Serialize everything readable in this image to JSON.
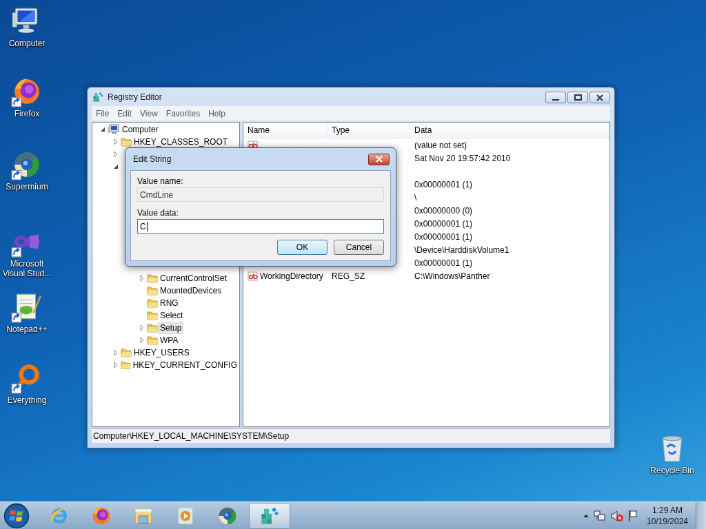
{
  "desktop_icons": [
    {
      "kind": "computer",
      "label": "Computer",
      "shortcut": false
    },
    {
      "kind": "firefox",
      "label": "Firefox",
      "shortcut": true
    },
    {
      "kind": "supermium",
      "label": "Supermium",
      "shortcut": true
    },
    {
      "kind": "vs",
      "label": "Microsoft Visual Stud...",
      "shortcut": true
    },
    {
      "kind": "notepad",
      "label": "Notepad++",
      "shortcut": true
    },
    {
      "kind": "everything",
      "label": "Everything",
      "shortcut": true
    },
    {
      "kind": "recycle",
      "label": "Recycle Bin",
      "shortcut": false
    }
  ],
  "registry_editor": {
    "title": "Registry Editor",
    "menu": [
      "File",
      "Edit",
      "View",
      "Favorites",
      "Help"
    ],
    "tree": {
      "label": "Computer",
      "kind": "computer",
      "expanded": true,
      "selected": false,
      "children": [
        {
          "label": "HKEY_CLASSES_ROOT",
          "expanded": false,
          "selected": false
        },
        {
          "expanded": false
        },
        {
          "expanded": true,
          "children": [
            {
              "covered": true
            },
            {
              "covered": true
            },
            {
              "covered": true
            },
            {
              "covered": true
            },
            {
              "covered": true
            },
            {
              "covered": true,
              "children": [
                {
                  "covered": true
                },
                {
                  "covered": true
                },
                {
                  "label": "CurrentControlSet",
                  "expanded": false,
                  "selected": false
                },
                {
                  "label": "MountedDevices",
                  "selected": false
                },
                {
                  "label": "RNG",
                  "selected": false
                },
                {
                  "label": "Select",
                  "selected": false
                },
                {
                  "label": "Setup",
                  "expanded": false,
                  "selected": true
                },
                {
                  "label": "WPA",
                  "expanded": false,
                  "selected": false
                }
              ]
            }
          ]
        },
        {
          "label": "HKEY_USERS",
          "expanded": false,
          "selected": false
        },
        {
          "label": "HKEY_CURRENT_CONFIG",
          "expanded": false,
          "selected": false
        }
      ]
    },
    "columns": [
      "Name",
      "Type",
      "Data"
    ],
    "rows": [
      {
        "kind": "string",
        "data": "(value not set)"
      },
      {
        "data": "Sat Nov 20 19:57:42 2010"
      },
      {
        "covered": true
      },
      {
        "data": "0x00000001 (1)"
      },
      {
        "data": "\\"
      },
      {
        "data": "0x00000000 (0)"
      },
      {
        "data": "0x00000001 (1)"
      },
      {
        "data": "0x00000001 (1)"
      },
      {
        "data": "\\Device\\HarddiskVolume1"
      },
      {
        "data": "0x00000001 (1)"
      },
      {
        "kind": "string",
        "name": "WorkingDirectory",
        "type": "REG_SZ",
        "data": "C:\\Windows\\Panther"
      }
    ],
    "status_bar": "Computer\\HKEY_LOCAL_MACHINE\\SYSTEM\\Setup"
  },
  "dialog": {
    "title": "Edit String",
    "fields": [
      {
        "label": "Value name:",
        "value": "CmdLine",
        "disabled": true,
        "focused": false
      },
      {
        "label": "Value data:",
        "value": "C",
        "disabled": false,
        "focused": true
      }
    ],
    "buttons": [
      {
        "label": "OK",
        "default": true
      },
      {
        "label": "Cancel",
        "default": false
      }
    ]
  },
  "taskbar": {
    "items": [
      {
        "kind": "ie",
        "selected": false
      },
      {
        "kind": "firefox",
        "selected": false
      },
      {
        "kind": "explorer",
        "selected": false
      },
      {
        "kind": "media",
        "selected": false
      },
      {
        "kind": "supermium",
        "selected": false
      },
      {
        "kind": "regedit",
        "selected": true
      }
    ],
    "tray": {
      "volume_muted": true,
      "time": "1:29 AM",
      "date": "10/19/2024"
    }
  }
}
